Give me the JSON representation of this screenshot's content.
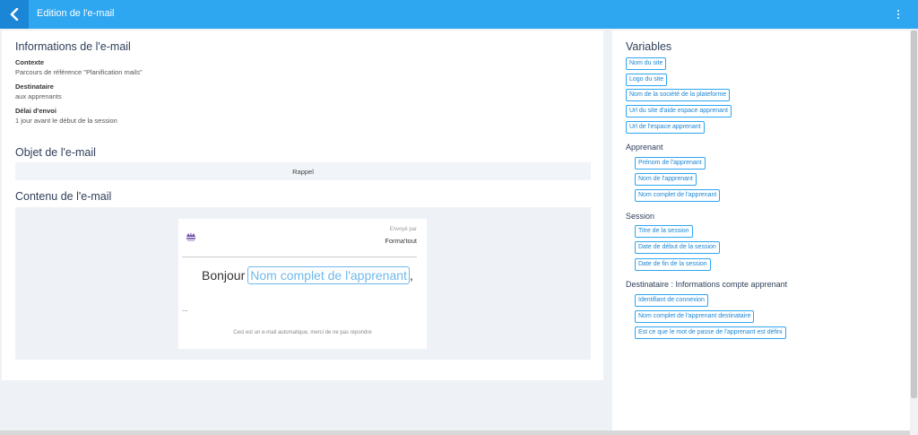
{
  "header": {
    "title": "Edition de l'e-mail"
  },
  "info": {
    "heading": "Informations de l'e-mail",
    "context_label": "Contexte",
    "context_value": "Parcours de référence \"Planification mails\"",
    "recipient_label": "Destinataire",
    "recipient_value": "aux apprenants",
    "delay_label": "Délai d'envoi",
    "delay_value": "1 jour avant le début de la session"
  },
  "subject": {
    "heading": "Objet de l'e-mail",
    "value": "Rappel"
  },
  "content": {
    "heading": "Contenu de l'e-mail",
    "sent_by": "Envoyé par",
    "sender": "Forma'tout",
    "greeting": "Bonjour",
    "greeting_variable": "Nom complet de l'apprenant",
    "greeting_end": ",",
    "ellipsis": "...",
    "footer": "Ceci est un e-mail automatique, merci de ne pas répondre"
  },
  "variables": {
    "title": "Variables",
    "site": [
      "Nom du site",
      "Logo du site",
      "Nom de la société de la plateforme",
      "Url du site d'aide espace apprenant",
      "Url de l'espace apprenant"
    ],
    "learner_title": "Apprenant",
    "learner": [
      "Prénom de l'apprenant",
      "Nom de l'apprenant",
      "Nom complet de l'apprenant"
    ],
    "session_title": "Session",
    "session": [
      "Titre de la session",
      "Date de début de la session",
      "Date de fin de la session"
    ],
    "recipient_title": "Destinataire : Informations compte apprenant",
    "recipient": [
      "Identifiant de connexion",
      "Nom complet de l'apprenant destinataire",
      "Est ce que le mot de passe de l'apprenant est défini"
    ]
  },
  "colors": {
    "accent": "#2ea6f0",
    "back_button": "#1b86d6",
    "heading": "#2f3f5a"
  }
}
